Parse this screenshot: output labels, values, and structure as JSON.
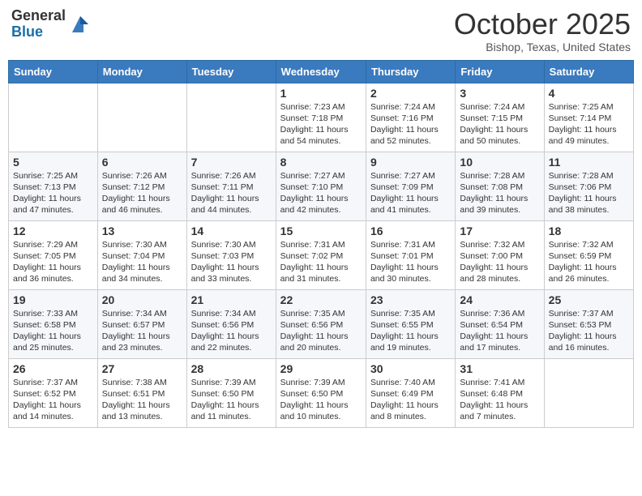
{
  "header": {
    "logo_general": "General",
    "logo_blue": "Blue",
    "month": "October 2025",
    "location": "Bishop, Texas, United States"
  },
  "days_of_week": [
    "Sunday",
    "Monday",
    "Tuesday",
    "Wednesday",
    "Thursday",
    "Friday",
    "Saturday"
  ],
  "weeks": [
    [
      {
        "day": "",
        "info": ""
      },
      {
        "day": "",
        "info": ""
      },
      {
        "day": "",
        "info": ""
      },
      {
        "day": "1",
        "info": "Sunrise: 7:23 AM\nSunset: 7:18 PM\nDaylight: 11 hours and 54 minutes."
      },
      {
        "day": "2",
        "info": "Sunrise: 7:24 AM\nSunset: 7:16 PM\nDaylight: 11 hours and 52 minutes."
      },
      {
        "day": "3",
        "info": "Sunrise: 7:24 AM\nSunset: 7:15 PM\nDaylight: 11 hours and 50 minutes."
      },
      {
        "day": "4",
        "info": "Sunrise: 7:25 AM\nSunset: 7:14 PM\nDaylight: 11 hours and 49 minutes."
      }
    ],
    [
      {
        "day": "5",
        "info": "Sunrise: 7:25 AM\nSunset: 7:13 PM\nDaylight: 11 hours and 47 minutes."
      },
      {
        "day": "6",
        "info": "Sunrise: 7:26 AM\nSunset: 7:12 PM\nDaylight: 11 hours and 46 minutes."
      },
      {
        "day": "7",
        "info": "Sunrise: 7:26 AM\nSunset: 7:11 PM\nDaylight: 11 hours and 44 minutes."
      },
      {
        "day": "8",
        "info": "Sunrise: 7:27 AM\nSunset: 7:10 PM\nDaylight: 11 hours and 42 minutes."
      },
      {
        "day": "9",
        "info": "Sunrise: 7:27 AM\nSunset: 7:09 PM\nDaylight: 11 hours and 41 minutes."
      },
      {
        "day": "10",
        "info": "Sunrise: 7:28 AM\nSunset: 7:08 PM\nDaylight: 11 hours and 39 minutes."
      },
      {
        "day": "11",
        "info": "Sunrise: 7:28 AM\nSunset: 7:06 PM\nDaylight: 11 hours and 38 minutes."
      }
    ],
    [
      {
        "day": "12",
        "info": "Sunrise: 7:29 AM\nSunset: 7:05 PM\nDaylight: 11 hours and 36 minutes."
      },
      {
        "day": "13",
        "info": "Sunrise: 7:30 AM\nSunset: 7:04 PM\nDaylight: 11 hours and 34 minutes."
      },
      {
        "day": "14",
        "info": "Sunrise: 7:30 AM\nSunset: 7:03 PM\nDaylight: 11 hours and 33 minutes."
      },
      {
        "day": "15",
        "info": "Sunrise: 7:31 AM\nSunset: 7:02 PM\nDaylight: 11 hours and 31 minutes."
      },
      {
        "day": "16",
        "info": "Sunrise: 7:31 AM\nSunset: 7:01 PM\nDaylight: 11 hours and 30 minutes."
      },
      {
        "day": "17",
        "info": "Sunrise: 7:32 AM\nSunset: 7:00 PM\nDaylight: 11 hours and 28 minutes."
      },
      {
        "day": "18",
        "info": "Sunrise: 7:32 AM\nSunset: 6:59 PM\nDaylight: 11 hours and 26 minutes."
      }
    ],
    [
      {
        "day": "19",
        "info": "Sunrise: 7:33 AM\nSunset: 6:58 PM\nDaylight: 11 hours and 25 minutes."
      },
      {
        "day": "20",
        "info": "Sunrise: 7:34 AM\nSunset: 6:57 PM\nDaylight: 11 hours and 23 minutes."
      },
      {
        "day": "21",
        "info": "Sunrise: 7:34 AM\nSunset: 6:56 PM\nDaylight: 11 hours and 22 minutes."
      },
      {
        "day": "22",
        "info": "Sunrise: 7:35 AM\nSunset: 6:56 PM\nDaylight: 11 hours and 20 minutes."
      },
      {
        "day": "23",
        "info": "Sunrise: 7:35 AM\nSunset: 6:55 PM\nDaylight: 11 hours and 19 minutes."
      },
      {
        "day": "24",
        "info": "Sunrise: 7:36 AM\nSunset: 6:54 PM\nDaylight: 11 hours and 17 minutes."
      },
      {
        "day": "25",
        "info": "Sunrise: 7:37 AM\nSunset: 6:53 PM\nDaylight: 11 hours and 16 minutes."
      }
    ],
    [
      {
        "day": "26",
        "info": "Sunrise: 7:37 AM\nSunset: 6:52 PM\nDaylight: 11 hours and 14 minutes."
      },
      {
        "day": "27",
        "info": "Sunrise: 7:38 AM\nSunset: 6:51 PM\nDaylight: 11 hours and 13 minutes."
      },
      {
        "day": "28",
        "info": "Sunrise: 7:39 AM\nSunset: 6:50 PM\nDaylight: 11 hours and 11 minutes."
      },
      {
        "day": "29",
        "info": "Sunrise: 7:39 AM\nSunset: 6:50 PM\nDaylight: 11 hours and 10 minutes."
      },
      {
        "day": "30",
        "info": "Sunrise: 7:40 AM\nSunset: 6:49 PM\nDaylight: 11 hours and 8 minutes."
      },
      {
        "day": "31",
        "info": "Sunrise: 7:41 AM\nSunset: 6:48 PM\nDaylight: 11 hours and 7 minutes."
      },
      {
        "day": "",
        "info": ""
      }
    ]
  ]
}
